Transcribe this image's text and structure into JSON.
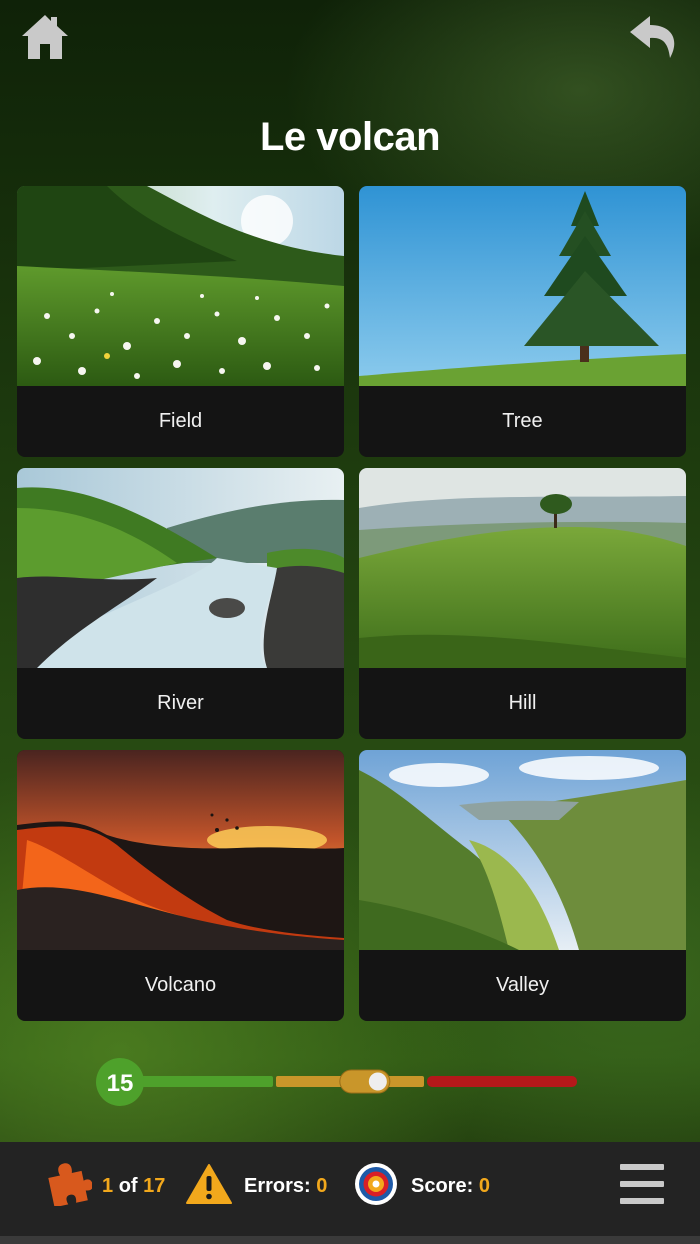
{
  "header": {
    "title": "Le volcan",
    "home_icon": "home-icon",
    "back_icon": "undo-arrow-icon"
  },
  "cards": [
    {
      "label": "Field",
      "image": "meadow-daisies-photo"
    },
    {
      "label": "Tree",
      "image": "single-pine-tree-photo"
    },
    {
      "label": "River",
      "image": "mountain-river-photo"
    },
    {
      "label": "Hill",
      "image": "green-hill-tree-photo"
    },
    {
      "label": "Volcano",
      "image": "erupting-lava-photo"
    },
    {
      "label": "Valley",
      "image": "green-valley-photo"
    }
  ],
  "timer": {
    "value": "15",
    "position_fraction": 0.52,
    "colors": {
      "green": "#4ea12b",
      "yellow": "#c9962a",
      "red": "#b5181a"
    }
  },
  "footer": {
    "progress_current": "1",
    "progress_of": "of",
    "progress_total": "17",
    "errors_label": "Errors:",
    "errors_value": "0",
    "score_label": "Score:",
    "score_value": "0",
    "icons": [
      "puzzle-icon",
      "warning-icon",
      "target-icon",
      "menu-icon"
    ]
  },
  "colors": {
    "accent": "#f2a81c",
    "card_bg": "#141414",
    "bar_bg": "#232323"
  }
}
